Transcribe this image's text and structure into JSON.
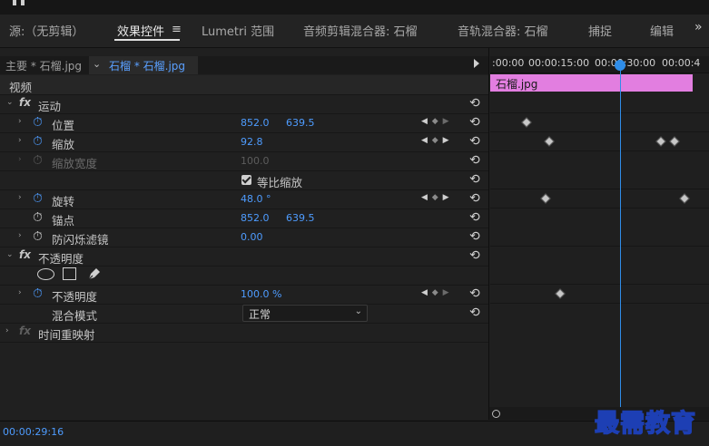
{
  "tabs": {
    "source": "源:（无剪辑）",
    "effect_controls": "效果控件",
    "menu_glyph": "≡",
    "lumetri": "Lumetri 范围",
    "audio_clip_mixer": "音频剪辑混合器: 石榴",
    "audio_track_mixer": "音轨混合器: 石榴",
    "capture": "捕捉",
    "edit": "编辑",
    "more": "»"
  },
  "source_bar": {
    "master": "主要 * 石榴.jpg",
    "clip": "石榴 * 石榴.jpg",
    "chevron": "⌄"
  },
  "timeline": {
    "ruler": [
      ":00:00",
      "00:00:15:00",
      "00:00:30:00",
      "00:00:4"
    ],
    "clip_name": "石榴.jpg",
    "playhead_time": "00:00:29:16"
  },
  "panel": {
    "video_header": "视频",
    "fx": "fx",
    "motion": "运动",
    "position": {
      "label": "位置",
      "x": "852.0",
      "y": "639.5"
    },
    "scale": {
      "label": "缩放",
      "value": "92.8"
    },
    "scale_width": {
      "label": "缩放宽度",
      "value": "100.0"
    },
    "uniform_scale": {
      "label": "等比缩放",
      "checked": true
    },
    "rotation": {
      "label": "旋转",
      "value": "48.0 °"
    },
    "anchor": {
      "label": "锚点",
      "x": "852.0",
      "y": "639.5"
    },
    "anti_flicker": {
      "label": "防闪烁滤镜",
      "value": "0.00"
    },
    "opacity_group": "不透明度",
    "opacity": {
      "label": "不透明度",
      "value": "100.0 %"
    },
    "blend_mode": {
      "label": "混合模式",
      "value": "正常"
    },
    "time_remap": "时间重映射"
  },
  "status": {
    "timecode": "00:00:29:16"
  },
  "watermark": "最需教育",
  "icons": {
    "stopwatch": "stopwatch-icon",
    "reset": "reset-icon",
    "twirl": "twirl-arrow-icon",
    "keyframe": "keyframe-diamond-icon",
    "pen": "pen-icon"
  },
  "colors": {
    "accent_blue": "#4e9cff",
    "clip_pink": "#e27ee0",
    "playhead": "#2f8de8"
  }
}
